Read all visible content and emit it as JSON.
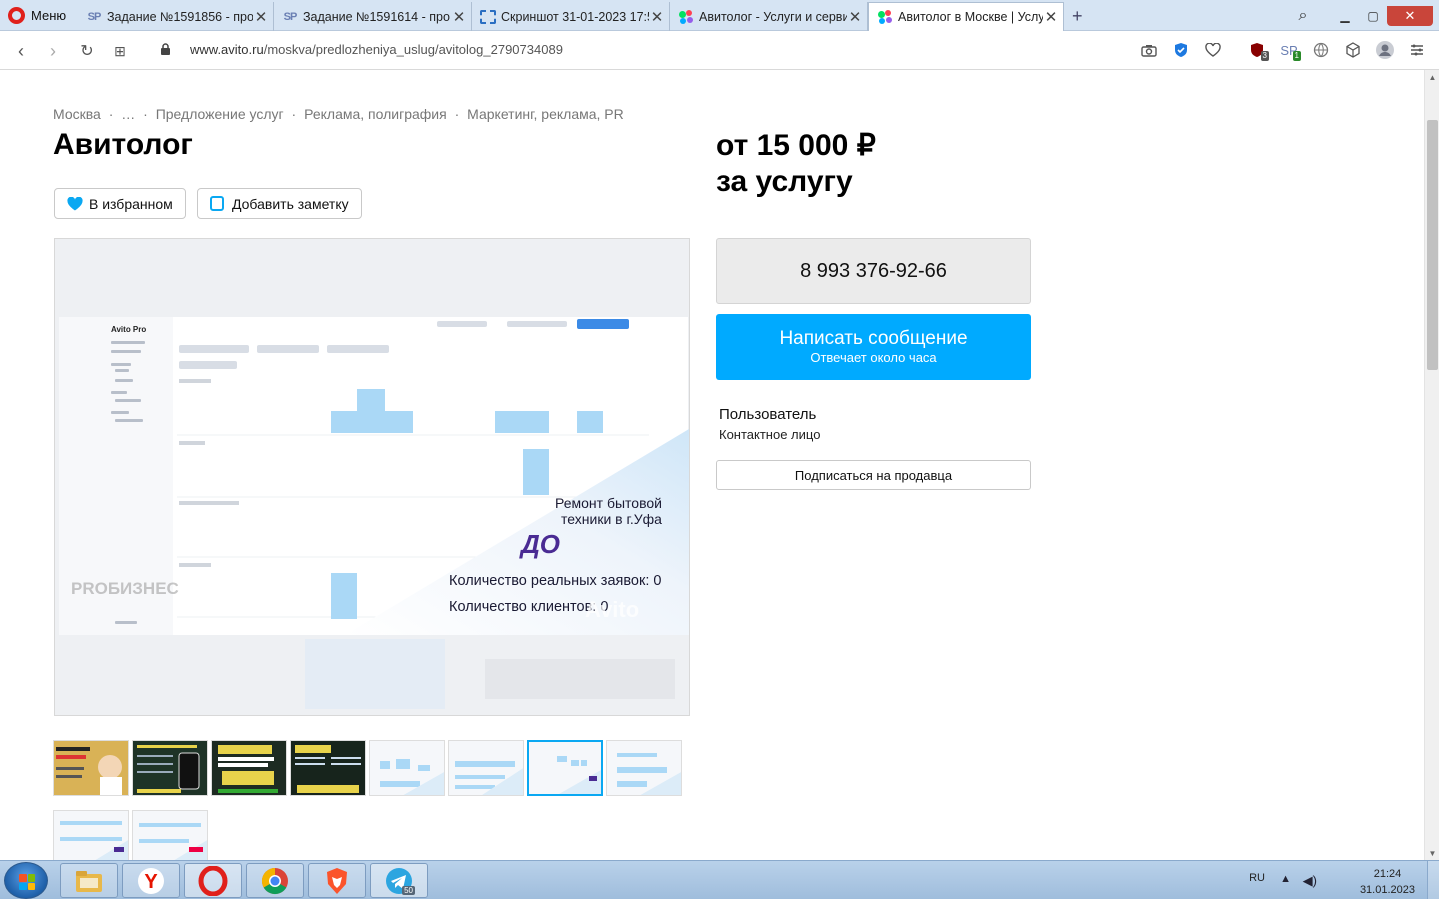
{
  "browser": {
    "menu_label": "Меню",
    "tabs": [
      {
        "title": "Задание №1591856 - про",
        "icon": "sp-icon"
      },
      {
        "title": "Задание №1591614 - про",
        "icon": "sp-icon"
      },
      {
        "title": "Скриншот 31-01-2023 17:5",
        "icon": "screenshot-icon"
      },
      {
        "title": "Авитолог - Услуги и серви",
        "icon": "avito-icon"
      },
      {
        "title": "Авитолог в Москве | Услуг",
        "icon": "avito-icon",
        "active": true
      }
    ],
    "url_host": "www.avito.ru",
    "url_path": "/moskva/predlozheniya_uslug/avitolog_2790734089",
    "ext_badges": {
      "ublock": "3",
      "sp": "1"
    }
  },
  "page": {
    "breadcrumb": [
      "Москва",
      "·",
      "…",
      "·",
      "Предложение услуг",
      "·",
      "Реклама, полиграфия",
      "·",
      "Маркетинг, реклама, PR"
    ],
    "title": "Авитолог",
    "price_line1": "от 15 000 ₽",
    "price_line2": "за услугу",
    "fav_label": "В избранном",
    "note_label": "Добавить заметку",
    "phone": "8 993 376-92-66",
    "message_label": "Написать сообщение",
    "message_sub": "Отвечает около часа",
    "seller_name": "Пользователь",
    "seller_role": "Контактное лицо",
    "subscribe_label": "Подписаться на продавца",
    "image": {
      "logo": "Avito Pro",
      "headline": "Ремонт бытовой",
      "headline2": "техники в г.Уфа",
      "badge": "ДО",
      "line1": "Количество реальных заявок: 0",
      "line2": "Количество клиентов: 0",
      "watermark1": "PROБИЗНЕС",
      "watermark2": "Avito"
    },
    "thumb_count": 10,
    "selected_thumb": 7
  },
  "taskbar": {
    "lang": "RU",
    "time": "21:24",
    "date": "31.01.2023",
    "telegram_badge": "50"
  },
  "colors": {
    "accent": "#00aaff",
    "tabstrip": "#d6e4f3",
    "opera_red": "#e0201b"
  }
}
